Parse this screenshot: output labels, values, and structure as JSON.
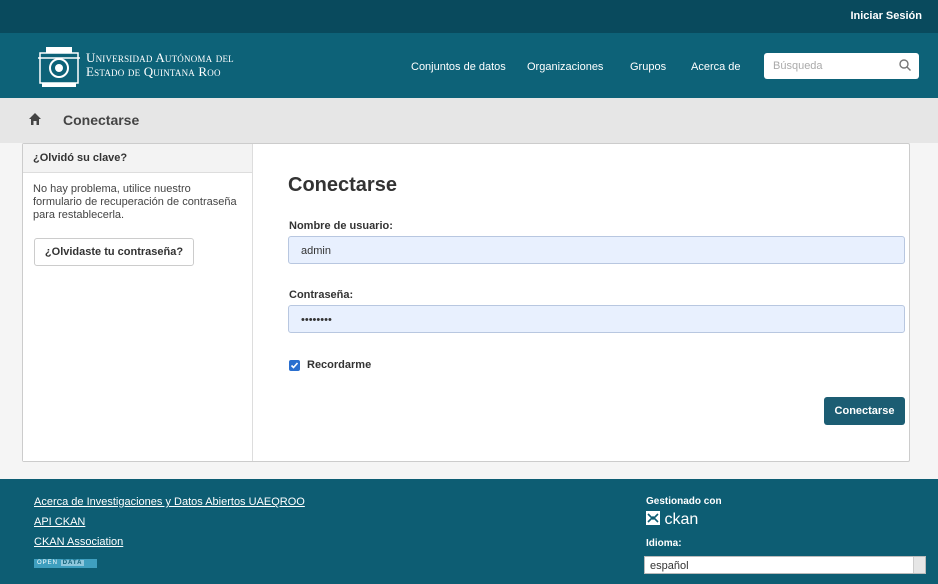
{
  "topbar": {
    "login": "Iniciar Sesión"
  },
  "header": {
    "brand_line1": "Universidad Autónoma del",
    "brand_line2": "Estado de Quintana Roo",
    "nav": [
      "Conjuntos de datos",
      "Organizaciones",
      "Grupos",
      "Acerca de"
    ],
    "search_placeholder": "Búsqueda"
  },
  "breadcrumb": {
    "current": "Conectarse"
  },
  "aside": {
    "title": "¿Olvidó su clave?",
    "text": "No hay problema, utilice nuestro formulario de recuperación de contraseña para restablecerla.",
    "button": "¿Olvidaste tu contraseña?"
  },
  "form": {
    "title": "Conectarse",
    "username_label": "Nombre de usuario:",
    "username_value": "admin",
    "password_label": "Contraseña:",
    "password_value": "••••••••",
    "remember_label": "Recordarme",
    "remember_checked": true,
    "submit": "Conectarse"
  },
  "footer": {
    "links": [
      "Acerca de Investigaciones y Datos Abiertos UAEQROO",
      "API CKAN",
      "CKAN Association"
    ],
    "badge_open": "OPEN",
    "badge_data": "DATA",
    "managed_by": "Gestionado con",
    "ckan": "ckan",
    "language_label": "Idioma:",
    "language_value": "español"
  },
  "colors": {
    "topbar": "#094a5d",
    "masthead": "#0d6278",
    "footer": "#0d5d73",
    "submit": "#1c5d73"
  },
  "icons": [
    "logo-crest-icon",
    "search-icon",
    "home-icon",
    "ckan-logo-icon",
    "checkbox-check-icon",
    "select-arrow-icon"
  ]
}
